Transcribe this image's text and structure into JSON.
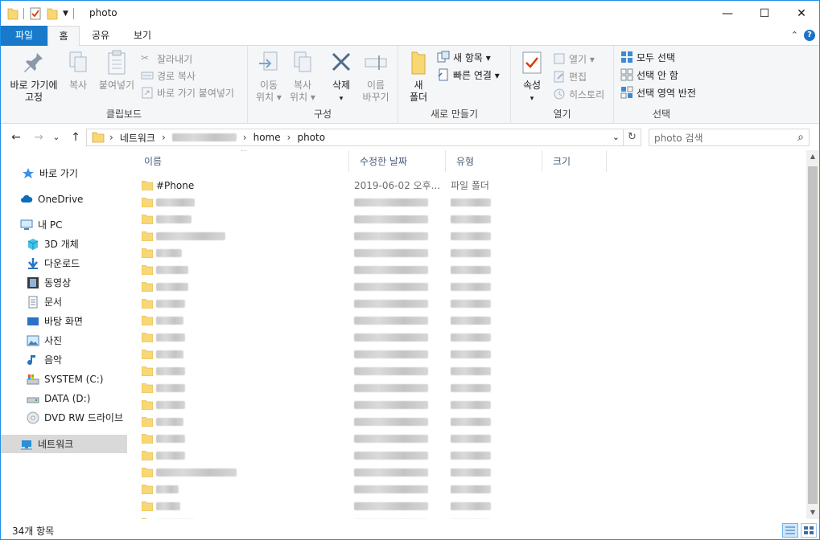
{
  "window": {
    "title": "photo",
    "minimize": "—",
    "maximize": "☐",
    "close": "✕"
  },
  "ribbon_tabs": [
    "파일",
    "홈",
    "공유",
    "보기"
  ],
  "ribbon_toggle": "⌃",
  "help": "?",
  "clipboard_group": {
    "label": "클립보드",
    "pin_label_1": "바로 가기에",
    "pin_label_2": "고정",
    "copy": "복사",
    "paste": "붙여넣기",
    "cut": "잘라내기",
    "copy_path": "경로 복사",
    "paste_shortcut": "바로 가기 붙여넣기"
  },
  "organize_group": {
    "label": "구성",
    "move_to_1": "이동",
    "move_to_2": "위치 ▾",
    "copy_to_1": "복사",
    "copy_to_2": "위치 ▾",
    "delete": "삭제",
    "delete_arrow": "▾",
    "rename_1": "이름",
    "rename_2": "바꾸기"
  },
  "new_group": {
    "label": "새로 만들기",
    "new_folder_1": "새",
    "new_folder_2": "폴더",
    "new_item": "새 항목 ▾",
    "easy_access": "빠른 연결 ▾"
  },
  "open_group": {
    "label": "열기",
    "properties": "속성",
    "properties_arrow": "▾",
    "open": "열기 ▾",
    "edit": "편집",
    "history": "히스토리"
  },
  "select_group": {
    "label": "선택",
    "select_all": "모두 선택",
    "select_none": "선택 안 함",
    "invert": "선택 영역 반전"
  },
  "address": {
    "back": "←",
    "forward": "→",
    "recent": "⌄",
    "up": "↑",
    "crumbs": [
      "네트워크",
      "home",
      "photo"
    ],
    "dropdown": "⌄",
    "refresh": "↻",
    "search_placeholder": "photo 검색",
    "search_icon": "⌕"
  },
  "navigation": [
    {
      "label": "바로 가기",
      "icon": "star-icon"
    },
    {
      "label": "OneDrive",
      "icon": "cloud-icon"
    },
    {
      "label": "내 PC",
      "icon": "pc-icon"
    },
    {
      "label": "3D 개체",
      "icon": "cube-icon"
    },
    {
      "label": "다운로드",
      "icon": "download-icon"
    },
    {
      "label": "동영상",
      "icon": "video-icon"
    },
    {
      "label": "문서",
      "icon": "document-icon"
    },
    {
      "label": "바탕 화면",
      "icon": "desktop-icon"
    },
    {
      "label": "사진",
      "icon": "pictures-icon"
    },
    {
      "label": "음악",
      "icon": "music-icon"
    },
    {
      "label": "SYSTEM (C:)",
      "icon": "drive-c-icon"
    },
    {
      "label": "DATA (D:)",
      "icon": "drive-d-icon"
    },
    {
      "label": "DVD RW 드라이브",
      "icon": "dvd-icon"
    },
    {
      "label": "네트워크",
      "icon": "network-icon"
    }
  ],
  "columns": [
    "이름",
    "수정한 날짜",
    "유형",
    "크기"
  ],
  "sort_indicator": "^",
  "files": [
    {
      "name": "#Phone",
      "date": "2019-06-02 오후...",
      "type": "파일 폴더",
      "blurred": false
    }
  ],
  "blurred_row_count": 20,
  "status": {
    "count": "34개 항목"
  },
  "colors": {
    "accent": "#1979ca",
    "folder": "#f8d775",
    "selected_nav": "#d9d9d9"
  }
}
